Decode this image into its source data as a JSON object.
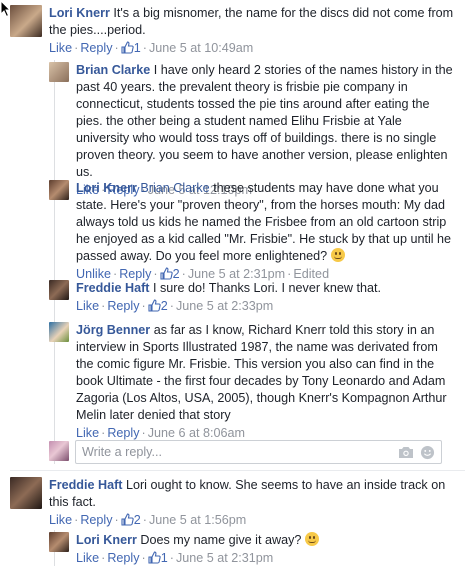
{
  "comments": [
    {
      "author": "Lori Knerr",
      "text": "It's a big misnomer, the name for the discs did not come from the pies....period.",
      "actions": {
        "like": "Like",
        "reply": "Reply",
        "like_count": "1",
        "time": "June 5 at 10:49am"
      }
    },
    {
      "author": "Brian Clarke",
      "text": "I have only heard 2 stories of the names history in the past 40 years. the prevalent theory is frisbie pie company in connecticut, students tossed the pie tins around after eating the pies. the other being a student named Elihu Frisbie at Yale university who would toss trays off of buildings. there is no single proven theory. you seem to have another version, please enlighten us.",
      "actions": {
        "like": "Like",
        "reply": "Reply",
        "time": "June 5 at 12:10pm"
      }
    },
    {
      "author": "Lori Knerr",
      "mention": "Brian Clarke",
      "text": "these students may have done what you state. Here's your \"proven theory\", from the horses mouth: My dad always told us kids he named the Frisbee from an old cartoon strip he enjoyed as a kid called \"Mr. Frisbie\". He stuck by that up until he passed away. Do you feel more enlightened?",
      "actions": {
        "like": "Unlike",
        "reply": "Reply",
        "like_count": "2",
        "time": "June 5 at 2:31pm",
        "edited": "Edited"
      }
    },
    {
      "author": "Freddie Haft",
      "text": "I sure do! Thanks Lori. I never knew that.",
      "actions": {
        "like": "Like",
        "reply": "Reply",
        "like_count": "2",
        "time": "June 5 at 2:33pm"
      }
    },
    {
      "author": "Jörg Benner",
      "text": "as far as I know, Richard Knerr told this story in an interview in Sports Illustrated 1987, the name was derivated from the comic figure Mr. Frisbie. This version you also can find in the book Ultimate - the first four decades by Tony Leonardo and Adam Zagoria (Los Altos, USA, 2005), though Knerr's Kompagnon Arthur Melin later denied that story",
      "actions": {
        "like": "Like",
        "reply": "Reply",
        "time": "June 6 at 8:06am"
      }
    },
    {
      "author": "Freddie Haft",
      "text": "Lori ought to know. She seems to have an inside track on this fact.",
      "actions": {
        "like": "Like",
        "reply": "Reply",
        "like_count": "2",
        "time": "June 5 at 1:56pm"
      }
    },
    {
      "author": "Lori Knerr",
      "text": "Does my name give it away?",
      "actions": {
        "like": "Like",
        "reply": "Reply",
        "like_count": "1",
        "time": "June 5 at 2:31pm"
      }
    }
  ],
  "reply_box": {
    "placeholder": "Write a reply..."
  },
  "icons": {
    "cursor": "cursor-arrow-icon",
    "camera": "camera-icon",
    "emoji": "emoji-icon",
    "thumb": "thumbs-up-icon"
  },
  "colors": {
    "link": "#365899",
    "action": "#4267b2",
    "meta": "#90949c"
  }
}
